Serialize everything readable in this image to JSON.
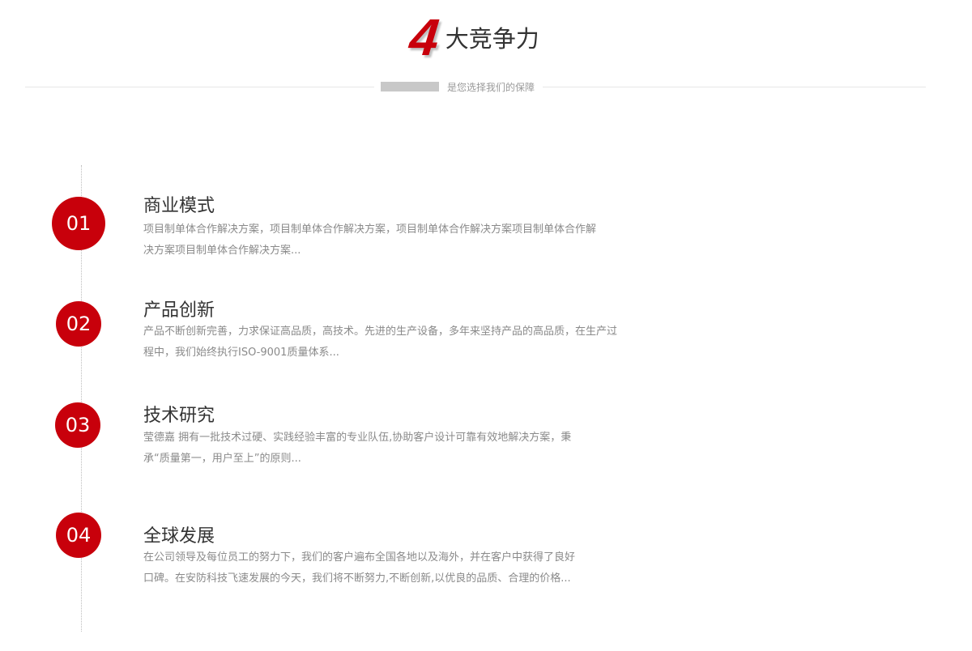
{
  "header": {
    "number": "4",
    "title": "大竞争力",
    "subtitle": "是您选择我们的保障"
  },
  "colors": {
    "accent": "#c8000b",
    "text": "#333333",
    "muted": "#8a8a8a",
    "divider": "#e6e6e6"
  },
  "items": [
    {
      "number": "01",
      "heading": "商业模式",
      "desc_line1": "项目制单体合作解决方案，项目制单体合作解决方案，项目制单体合作解决方案项目制单体合作解",
      "desc_line2": "决方案项目制单体合作解决方案..."
    },
    {
      "number": "02",
      "heading": "产品创新",
      "desc_line1": "产品不断创新完善，力求保证高品质，高技术。先进的生产设备，多年来坚持产品的高品质，在生产过",
      "desc_line2": "程中，我们始终执行ISO-9001质量体系..."
    },
    {
      "number": "03",
      "heading": "技术研究",
      "desc_line1": "莹德嘉 拥有一批技术过硬、实践经验丰富的专业队伍,协助客户设计可靠有效地解决方案，秉",
      "desc_line2": "承“质量第一，用户至上”的原则..."
    },
    {
      "number": "04",
      "heading": "全球发展",
      "desc_line1": "在公司领导及每位员工的努力下，我们的客户遍布全国各地以及海外，并在客户中获得了良好",
      "desc_line2": "口碑。在安防科技飞速发展的今天，我们将不断努力,不断创新,以优良的品质、合理的价格..."
    }
  ]
}
